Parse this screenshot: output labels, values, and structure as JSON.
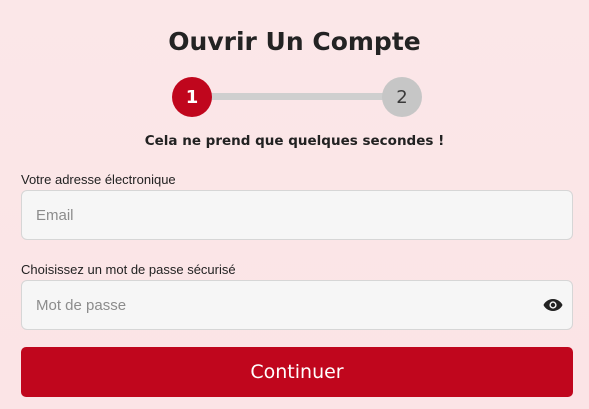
{
  "page": {
    "title": "Ouvrir Un Compte",
    "subtitle": "Cela ne prend que quelques secondes !"
  },
  "stepper": {
    "steps": [
      {
        "label": "1",
        "state": "active"
      },
      {
        "label": "2",
        "state": "inactive"
      }
    ],
    "active_color": "#c0061d",
    "inactive_color": "#c6c6c6"
  },
  "form": {
    "email": {
      "label": "Votre adresse électronique",
      "placeholder": "Email",
      "value": ""
    },
    "password": {
      "label": "Choisissez un mot de passe sécurisé",
      "placeholder": "Mot de passe",
      "value": "",
      "icon": "eye-icon"
    },
    "submit_label": "Continuer"
  },
  "colors": {
    "brand": "#c0061d",
    "background": "#fbe6e8"
  }
}
